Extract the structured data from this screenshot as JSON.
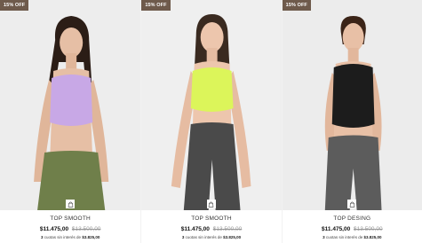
{
  "products": [
    {
      "badge": "15% OFF",
      "name": "TOP SMOOTH",
      "price": "$11.475,00",
      "old_price": "$13.500,00",
      "installments_count": "3",
      "installments_text": "cuotas sin interés de",
      "installments_amount": "$3.825,00",
      "top_color": "#c8a8e6",
      "bottom_color": "#6f7f4a"
    },
    {
      "badge": "15% OFF",
      "name": "TOP SMOOTH",
      "price": "$11.475,00",
      "old_price": "$13.500,00",
      "installments_count": "3",
      "installments_text": "cuotas sin interés de",
      "installments_amount": "$3.825,00",
      "top_color": "#dcf55a",
      "bottom_color": "#4a4a4a"
    },
    {
      "badge": "15% OFF",
      "name": "TOP DESING",
      "price": "$11.475,00",
      "old_price": "$13.500,00",
      "installments_count": "3",
      "installments_text": "cuotas sin interés de",
      "installments_amount": "$3.825,00",
      "top_color": "#1c1c1c",
      "bottom_color": "#5c5c5c"
    }
  ]
}
